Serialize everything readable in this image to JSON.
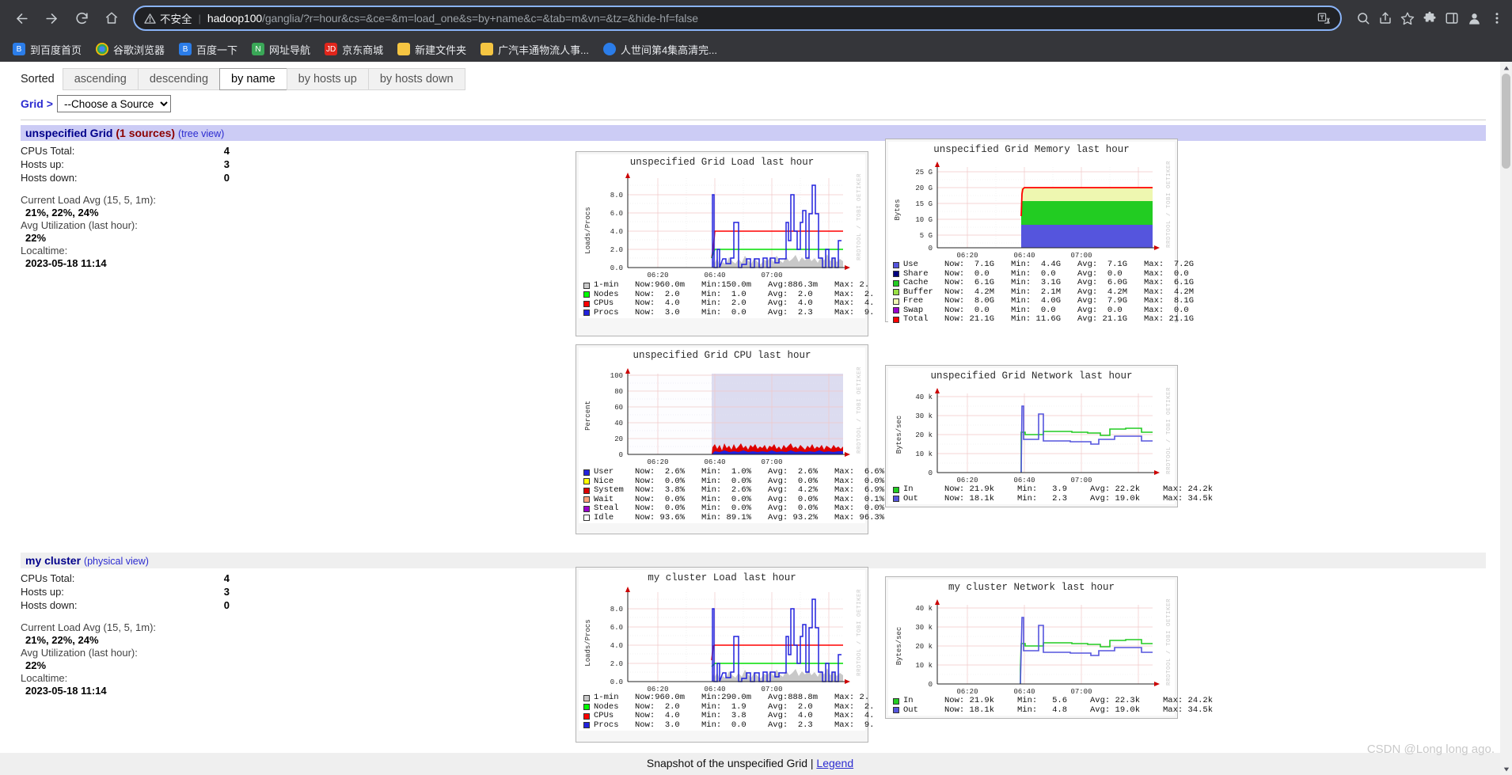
{
  "browser": {
    "nav": {
      "back": "back-arrow",
      "forward": "forward-arrow",
      "reload": "reload",
      "home": "home"
    },
    "omnibox": {
      "security_label": "不安全",
      "url_host": "hadoop100",
      "url_path": "/ganglia/?r=hour&cs=&ce=&m=load_one&s=by+name&c=&tab=m&vn=&tz=&hide-hf=false",
      "full_url": "hadoop100/ganglia/?r=hour&cs=&ce=&m=load_one&s=by+name&c=&tab=m&vn=&tz=&hide-hf=false"
    },
    "bookmarks": [
      {
        "label": "到百度首页",
        "icon": "baidu-paw-icon",
        "color": "#2b7de9"
      },
      {
        "label": "谷歌浏览器",
        "icon": "chrome-icon",
        "color": "#e8453c"
      },
      {
        "label": "百度一下",
        "icon": "baidu-paw-icon",
        "color": "#2b7de9"
      },
      {
        "label": "网址导航",
        "icon": "nav-site-icon",
        "color": "#3aa757"
      },
      {
        "label": "京东商城",
        "icon": "jd-icon",
        "color": "#e1251b"
      },
      {
        "label": "新建文件夹",
        "icon": "folder-icon",
        "color": "#f5c542"
      },
      {
        "label": "广汽丰通物流人事...",
        "icon": "folder-icon",
        "color": "#f5c542"
      },
      {
        "label": "人世间第4集高清完...",
        "icon": "video-icon",
        "color": "#2b7de9"
      }
    ]
  },
  "toolbar": {
    "sorted_label": "Sorted",
    "sort_tabs": [
      {
        "label": "ascending",
        "active": false
      },
      {
        "label": "descending",
        "active": false
      },
      {
        "label": "by name",
        "active": true
      },
      {
        "label": "by hosts up",
        "active": false
      },
      {
        "label": "by hosts down",
        "active": false
      }
    ],
    "grid_link": "Grid",
    "separator": ">",
    "source_select_value": "--Choose a Source",
    "source_options": [
      "--Choose a Source"
    ]
  },
  "clusters": [
    {
      "name": "unspecified Grid",
      "sources": "(1 sources)",
      "view_link": "(tree view)",
      "head_style": "grid",
      "stats": [
        {
          "key": "CPUs Total:",
          "value": "4"
        },
        {
          "key": "Hosts up:",
          "value": "3"
        },
        {
          "key": "Hosts down:",
          "value": "0"
        }
      ],
      "details": [
        {
          "key": "Current Load Avg (15, 5, 1m):",
          "value": "21%, 22%, 24%"
        },
        {
          "key": "Avg Utilization (last hour):",
          "value": "22%"
        },
        {
          "key": "Localtime:",
          "value": "2023-05-18 11:14"
        }
      ]
    },
    {
      "name": "my cluster",
      "sources": "",
      "view_link": "(physical view)",
      "head_style": "plain",
      "stats": [
        {
          "key": "CPUs Total:",
          "value": "4"
        },
        {
          "key": "Hosts up:",
          "value": "3"
        },
        {
          "key": "Hosts down:",
          "value": "0"
        }
      ],
      "details": [
        {
          "key": "Current Load Avg (15, 5, 1m):",
          "value": "21%, 22%, 24%"
        },
        {
          "key": "Avg Utilization (last hour):",
          "value": "22%"
        },
        {
          "key": "Localtime:",
          "value": "2023-05-18 11:14"
        }
      ]
    }
  ],
  "footer": {
    "text_before": "Snapshot of the unspecified Grid | ",
    "legend_link": "Legend",
    "watermark": "CSDN @Long long ago."
  },
  "chart_data": [
    {
      "id": "grid-load",
      "type": "line",
      "title": "unspecified Grid Load last hour",
      "ylabel": "Loads/Procs",
      "xlabel": "",
      "ytick_labels": [
        "0.0",
        "2.0",
        "4.0",
        "6.0",
        "8.0"
      ],
      "ylim": [
        0,
        9.5
      ],
      "xtick_labels": [
        "06:20",
        "06:40",
        "07:00"
      ],
      "watermark": "RRDTOOL / TOBI OETIKER",
      "legend_position": "bottom",
      "grid": true,
      "series": [
        {
          "name": "1-min",
          "color": "#c8c8c8",
          "now": "960.0m",
          "min": "150.0m",
          "avg": "886.3m",
          "max": "2."
        },
        {
          "name": "Nodes",
          "color": "#00ff00",
          "now": "2.0",
          "min": "1.0",
          "avg": "2.0",
          "max": "2."
        },
        {
          "name": "CPUs",
          "color": "#ff0000",
          "now": "4.0",
          "min": "2.0",
          "avg": "4.0",
          "max": "4."
        },
        {
          "name": "Procs",
          "color": "#2222dd",
          "now": "3.0",
          "min": "0.0",
          "avg": "2.3",
          "max": "9."
        }
      ],
      "legend_headers": [
        "Now:",
        "Min:",
        "Avg:",
        "Max:"
      ]
    },
    {
      "id": "grid-memory",
      "type": "area",
      "title": "unspecified Grid Memory last hour",
      "ylabel": "Bytes",
      "ytick_labels": [
        "0",
        "5 G",
        "10 G",
        "15 G",
        "20 G",
        "25 G"
      ],
      "ylim": [
        0,
        26
      ],
      "xtick_labels": [
        "06:20",
        "06:40",
        "07:00"
      ],
      "watermark": "RRDTOOL / TOBI OETIKER",
      "legend_position": "bottom",
      "grid": true,
      "series": [
        {
          "name": "Use",
          "color": "#5555dd",
          "now": "7.1G",
          "min": "4.4G",
          "avg": "7.1G",
          "max": "7.2G"
        },
        {
          "name": "Share",
          "color": "#000080",
          "now": "0.0",
          "min": "0.0",
          "avg": "0.0",
          "max": "0.0"
        },
        {
          "name": "Cache",
          "color": "#22cc22",
          "now": "6.1G",
          "min": "3.1G",
          "avg": "6.0G",
          "max": "6.1G"
        },
        {
          "name": "Buffer",
          "color": "#99e044",
          "now": "4.2M",
          "min": "2.1M",
          "avg": "4.2M",
          "max": "4.2M"
        },
        {
          "name": "Free",
          "color": "#eef7b0",
          "now": "8.0G",
          "min": "4.0G",
          "avg": "7.9G",
          "max": "8.1G"
        },
        {
          "name": "Swap",
          "color": "#9900cc",
          "now": "0.0",
          "min": "0.0",
          "avg": "0.0",
          "max": "0.0"
        },
        {
          "name": "Total",
          "color": "#ff0000",
          "now": "21.1G",
          "min": "11.6G",
          "avg": "21.1G",
          "max": "21.1G"
        }
      ],
      "legend_headers": [
        "Now:",
        "Min:",
        "Avg:",
        "Max:"
      ]
    },
    {
      "id": "grid-cpu",
      "type": "area",
      "title": "unspecified Grid CPU last hour",
      "ylabel": "Percent",
      "ytick_labels": [
        "0",
        "20",
        "40",
        "60",
        "80",
        "100"
      ],
      "ylim": [
        0,
        104
      ],
      "xtick_labels": [
        "06:20",
        "06:40",
        "07:00"
      ],
      "watermark": "RRDTOOL / TOBI OETIKER",
      "legend_position": "bottom",
      "grid": true,
      "series": [
        {
          "name": "User",
          "color": "#2222dd",
          "now": "2.6%",
          "min": "1.0%",
          "avg": "2.6%",
          "max": "6.6%"
        },
        {
          "name": "Nice",
          "color": "#ffff00",
          "now": "0.0%",
          "min": "0.0%",
          "avg": "0.0%",
          "max": "0.0%"
        },
        {
          "name": "System",
          "color": "#dd0000",
          "now": "3.8%",
          "min": "2.6%",
          "avg": "4.2%",
          "max": "6.9%"
        },
        {
          "name": "Wait",
          "color": "#ffa07a",
          "now": "0.0%",
          "min": "0.0%",
          "avg": "0.0%",
          "max": "0.1%"
        },
        {
          "name": "Steal",
          "color": "#9900cc",
          "now": "0.0%",
          "min": "0.0%",
          "avg": "0.0%",
          "max": "0.0%"
        },
        {
          "name": "Idle",
          "color": "#ffffff",
          "now": "93.6%",
          "min": "89.1%",
          "avg": "93.2%",
          "max": "96.3%"
        }
      ],
      "legend_headers": [
        "Now:",
        "Min:",
        "Avg:",
        "Max:"
      ]
    },
    {
      "id": "grid-network",
      "type": "line",
      "title": "unspecified Grid Network last hour",
      "ylabel": "Bytes/sec",
      "ytick_labels": [
        "0",
        "10 k",
        "20 k",
        "30 k",
        "40 k"
      ],
      "ylim": [
        0,
        42
      ],
      "xtick_labels": [
        "06:20",
        "06:40",
        "07:00"
      ],
      "watermark": "RRDTOOL / TOBI OETIKER",
      "legend_position": "bottom",
      "grid": true,
      "series": [
        {
          "name": "In",
          "color": "#22cc22",
          "now": "21.9k",
          "min": "3.9",
          "avg": "22.2k",
          "max": "24.2k"
        },
        {
          "name": "Out",
          "color": "#5555dd",
          "now": "18.1k",
          "min": "2.3",
          "avg": "19.0k",
          "max": "34.5k"
        }
      ],
      "legend_headers": [
        "Now:",
        "Min:",
        "Avg:",
        "Max:"
      ]
    },
    {
      "id": "cluster-load",
      "type": "line",
      "title": "my cluster Load last hour",
      "ylabel": "Loads/Procs",
      "ytick_labels": [
        "0.0",
        "2.0",
        "4.0",
        "6.0",
        "8.0"
      ],
      "ylim": [
        0,
        9.5
      ],
      "xtick_labels": [
        "06:20",
        "06:40",
        "07:00"
      ],
      "watermark": "RRDTOOL / TOBI OETIKER",
      "legend_position": "bottom",
      "grid": true,
      "series": [
        {
          "name": "1-min",
          "color": "#c8c8c8",
          "now": "960.0m",
          "min": "290.0m",
          "avg": "888.8m",
          "max": "2."
        },
        {
          "name": "Nodes",
          "color": "#00ff00",
          "now": "2.0",
          "min": "1.9",
          "avg": "2.0",
          "max": "2."
        },
        {
          "name": "CPUs",
          "color": "#ff0000",
          "now": "4.0",
          "min": "3.8",
          "avg": "4.0",
          "max": "4."
        },
        {
          "name": "Procs",
          "color": "#2222dd",
          "now": "3.0",
          "min": "0.0",
          "avg": "2.3",
          "max": "9."
        }
      ],
      "legend_headers": [
        "Now:",
        "Min:",
        "Avg:",
        "Max:"
      ]
    },
    {
      "id": "cluster-network",
      "type": "line",
      "title": "my cluster Network last hour",
      "ylabel": "Bytes/sec",
      "ytick_labels": [
        "0",
        "10 k",
        "20 k",
        "30 k",
        "40 k"
      ],
      "ylim": [
        0,
        42
      ],
      "xtick_labels": [
        "06:20",
        "06:40",
        "07:00"
      ],
      "watermark": "RRDTOOL / TOBI OETIKER",
      "legend_position": "bottom",
      "grid": true,
      "series": [
        {
          "name": "In",
          "color": "#22cc22",
          "now": "21.9k",
          "min": "5.6",
          "avg": "22.3k",
          "max": "24.2k"
        },
        {
          "name": "Out",
          "color": "#5555dd",
          "now": "18.1k",
          "min": "4.8",
          "avg": "19.0k",
          "max": "34.5k"
        }
      ],
      "legend_headers": [
        "Now:",
        "Min:",
        "Avg:",
        "Max:"
      ]
    }
  ]
}
